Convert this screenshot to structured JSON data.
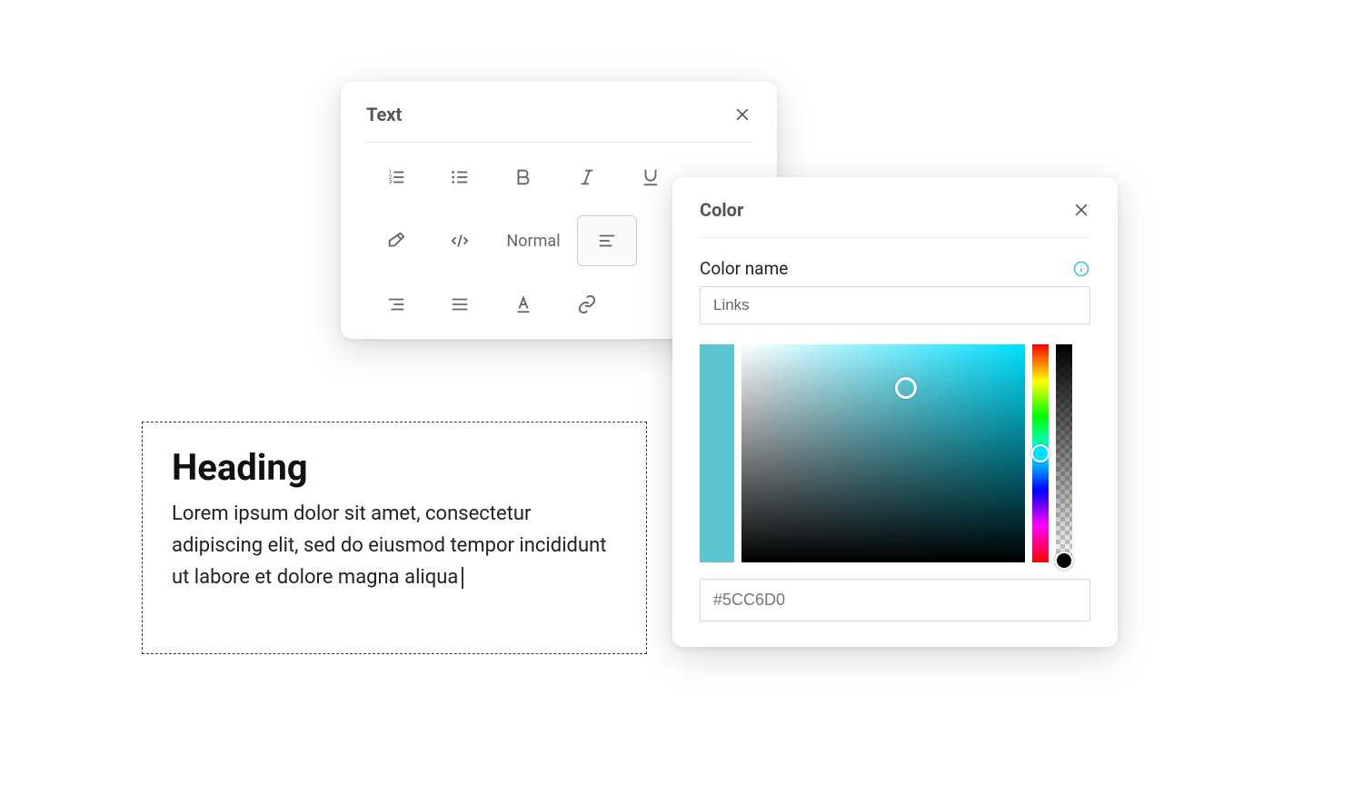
{
  "text_panel": {
    "title": "Text",
    "style_label": "Normal"
  },
  "edit_block": {
    "heading": "Heading",
    "body": "Lorem ipsum dolor sit amet, consectetur adipiscing elit, sed do eiusmod tempor incididunt ut labore et dolore magna aliqua"
  },
  "color_panel": {
    "title": "Color",
    "name_label": "Color name",
    "name_value": "Links",
    "hex_value": "#5CC6D0",
    "swatch_color": "#5CC6D0"
  }
}
